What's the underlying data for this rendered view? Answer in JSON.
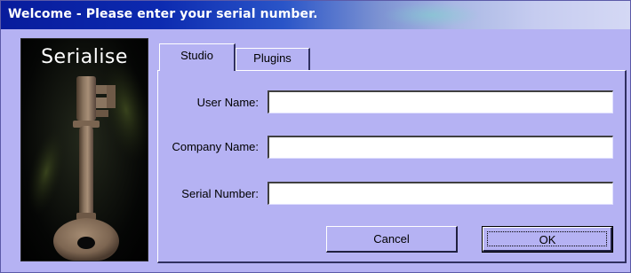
{
  "window": {
    "title": "Welcome - Please enter your serial number."
  },
  "side_panel": {
    "title": "Serialise",
    "image": "old-key-image"
  },
  "tabs": [
    {
      "label": "Studio",
      "selected": true
    },
    {
      "label": "Plugins",
      "selected": false
    }
  ],
  "form": {
    "user_name": {
      "label": "User Name:",
      "value": ""
    },
    "company_name": {
      "label": "Company Name:",
      "value": ""
    },
    "serial_number": {
      "label": "Serial Number:",
      "value": ""
    }
  },
  "buttons": {
    "cancel": "Cancel",
    "ok": "OK"
  },
  "colors": {
    "dialog_bg": "#b5b2f3",
    "titlebar_start": "#081c9c",
    "titlebar_end": "#d4d8f4",
    "panel_bg": "#000000"
  }
}
